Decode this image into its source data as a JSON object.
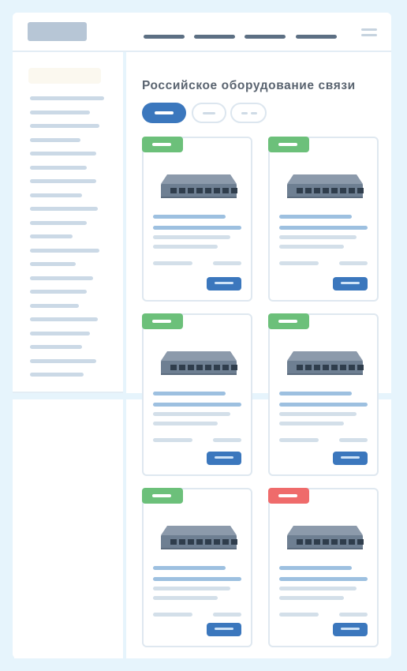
{
  "page": {
    "title": "Российское оборудование связи"
  },
  "colors": {
    "background": "#e6f4fc",
    "accent": "#3b77bd",
    "badge_green": "#6cc07a",
    "badge_red": "#ef6b6b",
    "nav_text": "#5c6f83"
  },
  "header": {
    "logo_icon": "logo-placeholder",
    "nav_link_count": 4,
    "menu_icon": "hamburger-icon"
  },
  "filters": {
    "active_index": 0,
    "count": 3
  },
  "sidebar": {
    "item_count": 21
  },
  "products": [
    {
      "badge": "green",
      "device_icon": "network-switch-icon"
    },
    {
      "badge": "green",
      "device_icon": "network-switch-icon"
    },
    {
      "badge": "green",
      "device_icon": "network-switch-icon"
    },
    {
      "badge": "green",
      "device_icon": "network-switch-icon"
    },
    {
      "badge": "green",
      "device_icon": "network-switch-icon"
    },
    {
      "badge": "red",
      "device_icon": "network-switch-icon"
    }
  ]
}
